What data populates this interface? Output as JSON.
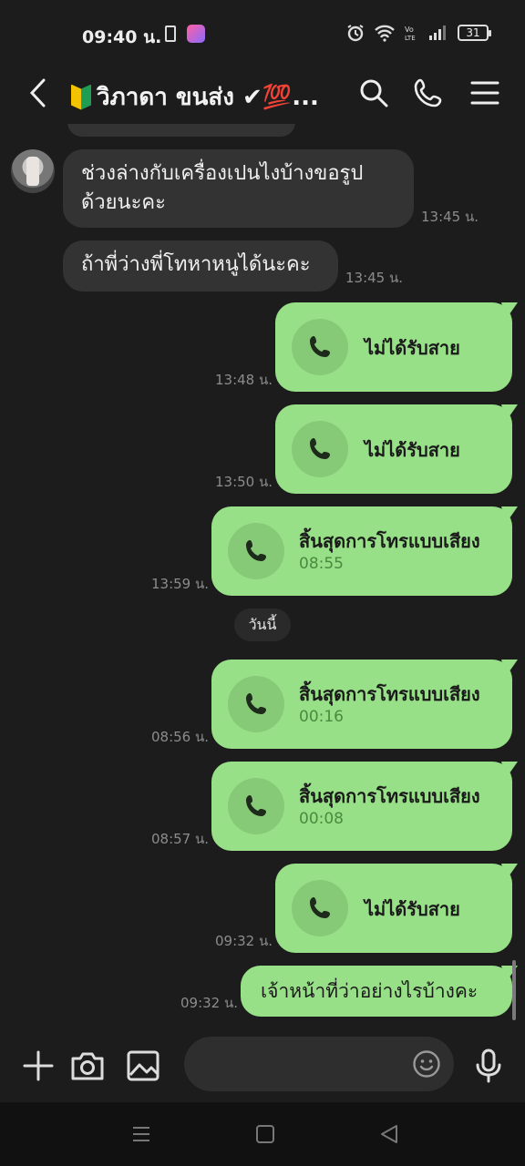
{
  "status_bar": {
    "time": "09:40 น.",
    "battery": "31"
  },
  "header": {
    "contact_name": "วิภาดา ขนส่ง ✔💯..."
  },
  "messages": [
    {
      "from": "contact",
      "text_line1": "ช่วงล่างกับเครื่องเปนไงบ้างขอรูป",
      "text_line2": "ด้วยนะคะ",
      "time": "13:45 น."
    },
    {
      "from": "contact",
      "text": "ถ้าพี่ว่างพี่โทหาหนูได้นะคะ",
      "time": "13:45 น."
    },
    {
      "from": "me",
      "type": "missed_call",
      "label": "ไม่ได้รับสาย",
      "time": "13:48 น."
    },
    {
      "from": "me",
      "type": "missed_call",
      "label": "ไม่ได้รับสาย",
      "time": "13:50 น."
    },
    {
      "from": "me",
      "type": "voice_call",
      "label": "สิ้นสุดการโทรแบบเสียง",
      "duration": "08:55",
      "time": "13:59 น."
    },
    {
      "from": "me",
      "type": "voice_call",
      "label": "สิ้นสุดการโทรแบบเสียง",
      "duration": "00:16",
      "time": "08:56 น."
    },
    {
      "from": "me",
      "type": "voice_call",
      "label": "สิ้นสุดการโทรแบบเสียง",
      "duration": "00:08",
      "time": "08:57 น."
    },
    {
      "from": "me",
      "type": "missed_call",
      "label": "ไม่ได้รับสาย",
      "time": "09:32 น."
    },
    {
      "from": "me",
      "type": "text",
      "text": "เจ้าหน้าที่ว่าอย่างไรบ้างคะ",
      "time": "09:32 น."
    }
  ],
  "day_separator": "วันนี้",
  "colors": {
    "outgoing_bubble": "#98e088",
    "incoming_bubble": "#333333",
    "background": "#1c1c1c"
  }
}
